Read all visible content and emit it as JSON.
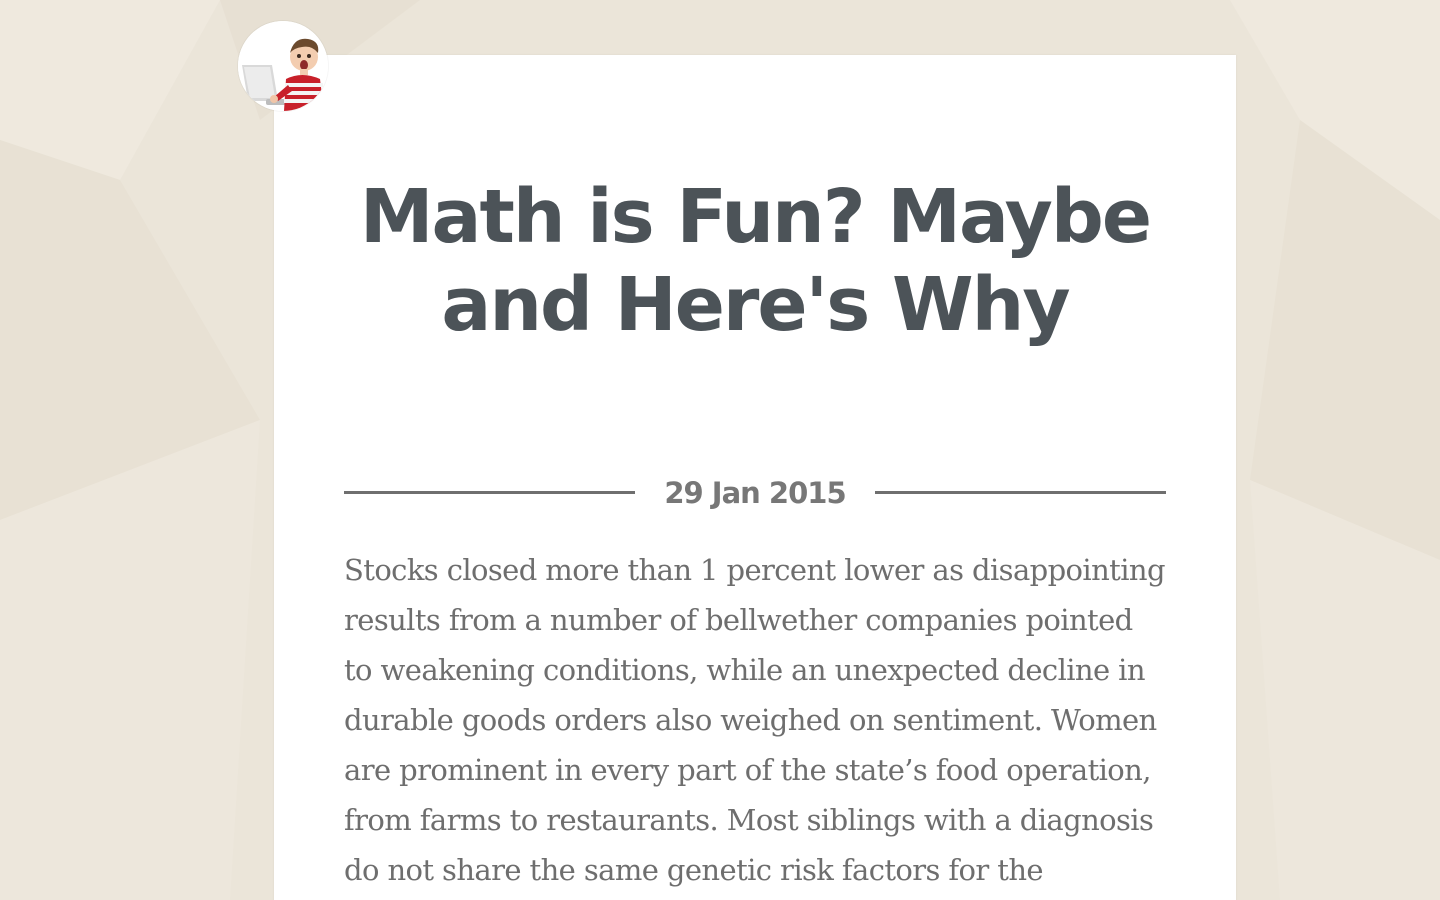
{
  "post": {
    "title": "Math is Fun? Maybe and Here's Why",
    "date": "29 Jan 2015",
    "body": "Stocks closed more than 1 percent lower as disappointing results from a number of bellwether companies pointed to weakening conditions, while an unexpected decline in durable goods orders also weighed on sentiment. Women are prominent in every part of the state’s food operation, from farms to restaurants. Most siblings with a diagnosis do not share the same genetic risk factors for the disorder"
  },
  "avatar": {
    "icon": "boy-with-laptop-avatar"
  },
  "colors": {
    "background": "#ebe5d9",
    "card": "#ffffff",
    "title": "#4c5358",
    "date": "#777777",
    "body": "#6e6e6e",
    "rule": "#6f6f6f"
  }
}
